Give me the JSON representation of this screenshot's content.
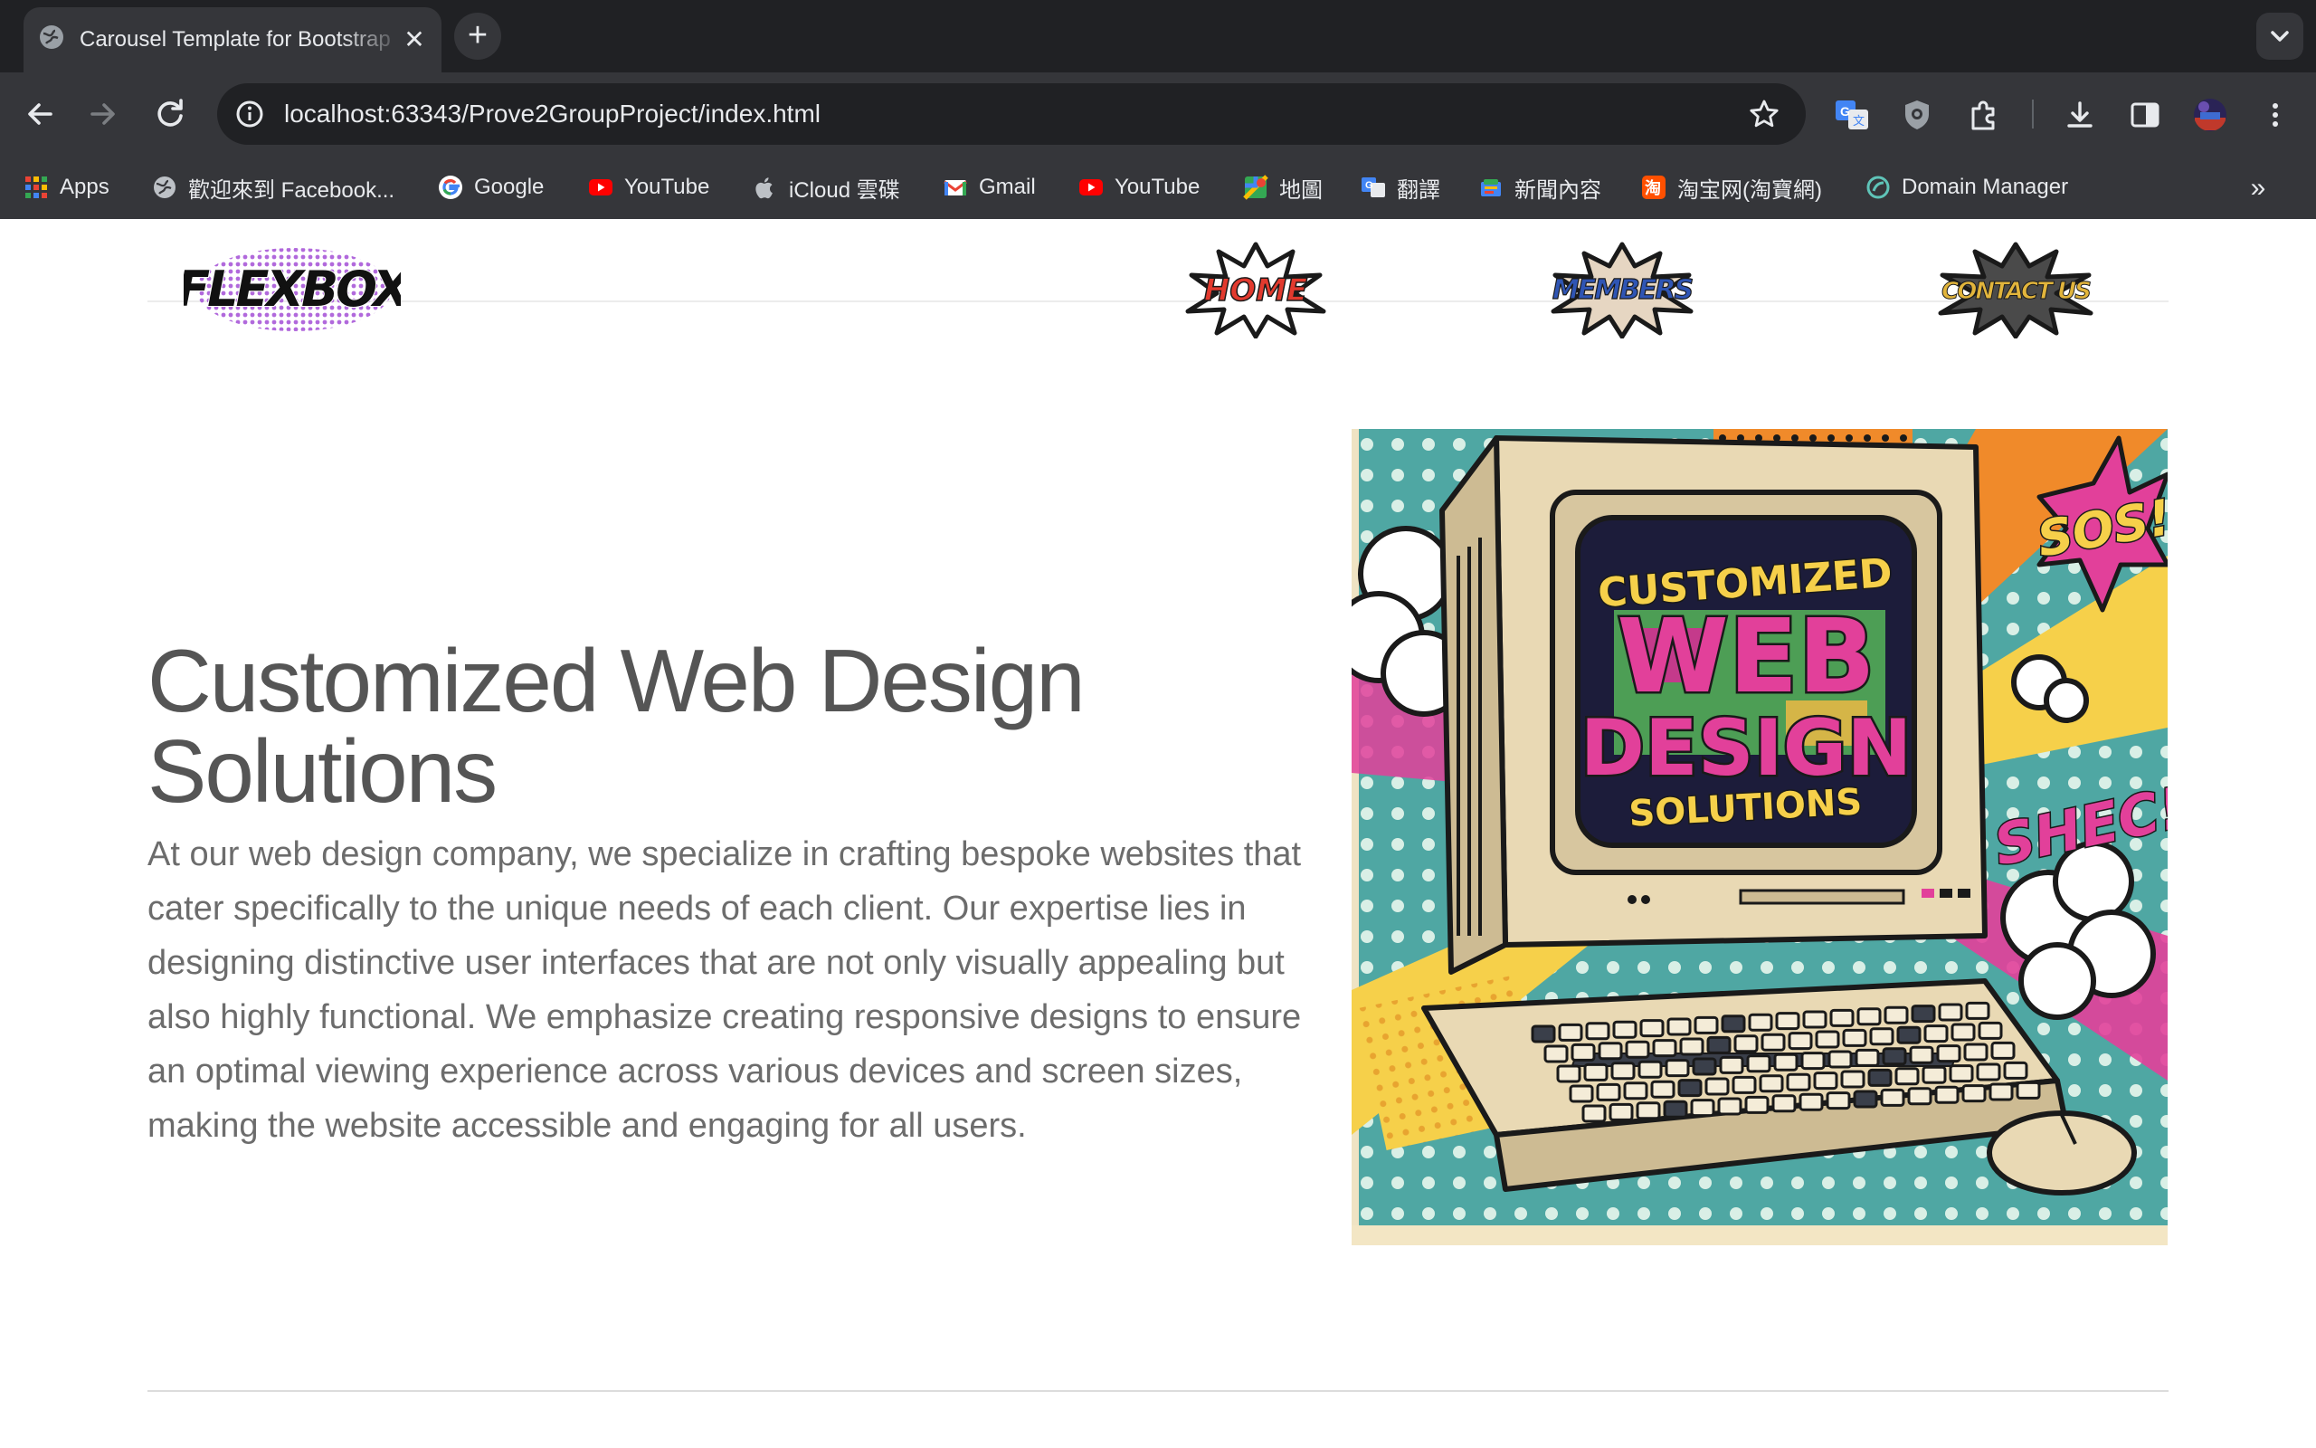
{
  "browser": {
    "tab": {
      "title": "Carousel Template for Bootstrap",
      "close_glyph": "✕"
    },
    "new_tab_glyph": "+",
    "url": "localhost:63343/Prove2GroupProject/index.html",
    "bookmarks": [
      {
        "label": "Apps",
        "icon": "apps-grid-icon"
      },
      {
        "label": "歡迎來到 Facebook...",
        "icon": "globe-icon"
      },
      {
        "label": "Google",
        "icon": "google-icon"
      },
      {
        "label": "YouTube",
        "icon": "youtube-icon"
      },
      {
        "label": "iCloud 雲碟",
        "icon": "apple-icon"
      },
      {
        "label": "Gmail",
        "icon": "gmail-icon"
      },
      {
        "label": "YouTube",
        "icon": "youtube-icon"
      },
      {
        "label": "地圖",
        "icon": "maps-icon"
      },
      {
        "label": "翻譯",
        "icon": "translate-icon"
      },
      {
        "label": "新聞內容",
        "icon": "news-icon"
      },
      {
        "label": "淘宝网(淘寶網)",
        "icon": "taobao-icon"
      },
      {
        "label": "Domain Manager",
        "icon": "domain-manager-icon"
      }
    ],
    "bookmarks_more_glyph": "»"
  },
  "site": {
    "logo_text": "FLEXBOX",
    "nav": [
      {
        "label": "HOME",
        "text_color": "#e23a2e",
        "burst_color": "#ffffff"
      },
      {
        "label": "MEMBERS",
        "text_color": "#2f55b4",
        "burst_color": "#e6d6c2"
      },
      {
        "label": "CONTACT US",
        "text_color": "#e2b53c",
        "burst_color": "#4a4a4a"
      }
    ],
    "hero": {
      "heading": "Customized Web Design Solutions",
      "body": "At our web design company, we specialize in crafting bespoke websites that cater specifically to the unique needs of each client. Our expertise lies in designing distinctive user interfaces that are not only visually appealing but also highly functional. We emphasize creating responsive designs to ensure an optimal viewing experience across various devices and screen sizes, making the website accessible and engaging for all users.",
      "image": {
        "screen_line1": "CUSTOMIZED",
        "screen_line2": "WEB",
        "screen_line3": "DESIGN",
        "screen_line4": "SOLUTIONS",
        "burst_1": "SOS!",
        "burst_2": "SHEC!",
        "palette": {
          "teal": "#4fa7a3",
          "cream": "#efe3c3",
          "orange": "#f08a2a",
          "pink": "#e2409a",
          "yellow": "#f6d04a",
          "screen": "#1c1c3a",
          "green": "#56b55a"
        }
      }
    }
  }
}
